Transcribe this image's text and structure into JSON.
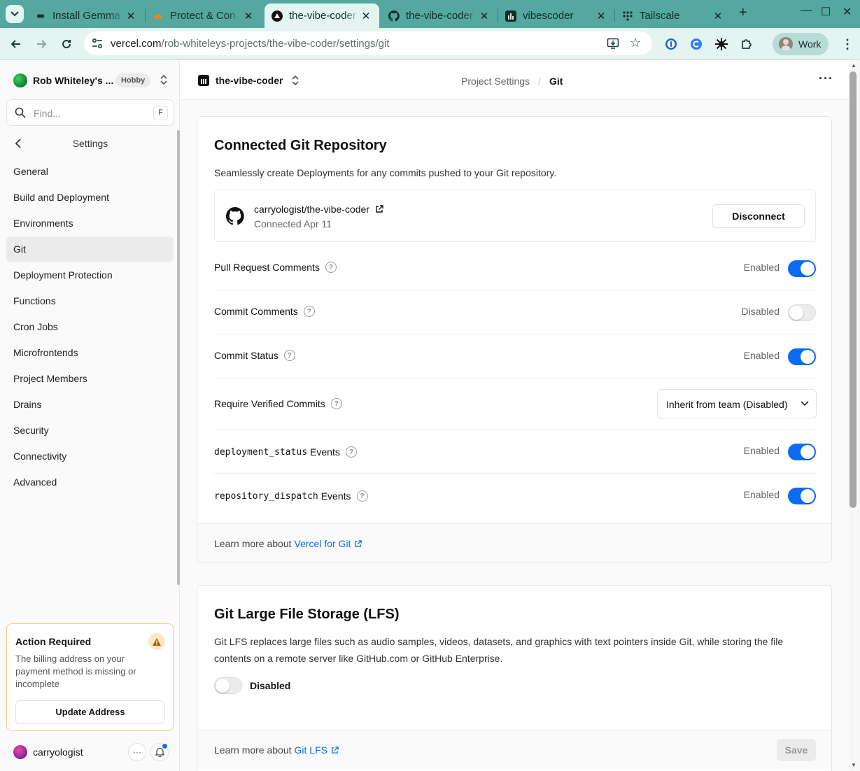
{
  "browser": {
    "tabs": [
      {
        "title": "Install Gemma",
        "icon": "infinity-icon"
      },
      {
        "title": "Protect & Con",
        "icon": "cloudflare-icon"
      },
      {
        "title": "the-vibe-coder",
        "icon": "vercel-icon",
        "active": true
      },
      {
        "title": "the-vibe-coder",
        "icon": "github-icon"
      },
      {
        "title": "vibescoder",
        "icon": "vercel-project-icon"
      },
      {
        "title": "Tailscale",
        "icon": "tailscale-icon"
      }
    ],
    "url_host": "vercel.com",
    "url_path": "/rob-whiteleys-projects/the-vibe-coder/settings/git",
    "profile_label": "Work"
  },
  "sidebar": {
    "team_name": "Rob Whiteley's ...",
    "plan_badge": "Hobby",
    "find_placeholder": "Find...",
    "find_shortcut": "F",
    "section_title": "Settings",
    "items": [
      {
        "label": "General"
      },
      {
        "label": "Build and Deployment"
      },
      {
        "label": "Environments"
      },
      {
        "label": "Git",
        "active": true
      },
      {
        "label": "Deployment Protection"
      },
      {
        "label": "Functions"
      },
      {
        "label": "Cron Jobs"
      },
      {
        "label": "Microfrontends"
      },
      {
        "label": "Project Members"
      },
      {
        "label": "Drains"
      },
      {
        "label": "Security"
      },
      {
        "label": "Connectivity"
      },
      {
        "label": "Advanced"
      }
    ],
    "action": {
      "title": "Action Required",
      "message": "The billing address on your payment method is missing or incomplete",
      "button": "Update Address"
    },
    "user_name": "carryologist"
  },
  "header": {
    "project_name": "the-vibe-coder",
    "crumb_parent": "Project Settings",
    "crumb_current": "Git"
  },
  "git_card": {
    "title": "Connected Git Repository",
    "description": "Seamlessly create Deployments for any commits pushed to your Git repository.",
    "repo_name": "carryologist/the-vibe-coder",
    "repo_connected": "Connected Apr 11",
    "disconnect_label": "Disconnect",
    "settings": [
      {
        "label": "Pull Request Comments",
        "status": "Enabled",
        "on": true
      },
      {
        "label": "Commit Comments",
        "status": "Disabled",
        "on": false
      },
      {
        "label": "Commit Status",
        "status": "Enabled",
        "on": true
      },
      {
        "label": "Require Verified Commits",
        "select_value": "Inherit from team (Disabled)"
      },
      {
        "code": "deployment_status",
        "label": "Events",
        "status": "Enabled",
        "on": true
      },
      {
        "code": "repository_dispatch",
        "label": "Events",
        "status": "Enabled",
        "on": true
      }
    ],
    "footer_text": "Learn more about",
    "footer_link": "Vercel for Git"
  },
  "lfs_card": {
    "title": "Git Large File Storage (LFS)",
    "description": "Git LFS replaces large files such as audio samples, videos, datasets, and graphics with text pointers inside Git, while storing the file contents on a remote server like GitHub.com or GitHub Enterprise.",
    "toggle_label": "Disabled",
    "footer_text": "Learn more about",
    "footer_link": "Git LFS",
    "save_label": "Save"
  },
  "colors": {
    "tabbar": "#54a89f",
    "toolbar": "#e3f4f1",
    "accent_blue": "#0a6cf0",
    "warning": "#f5a623"
  }
}
